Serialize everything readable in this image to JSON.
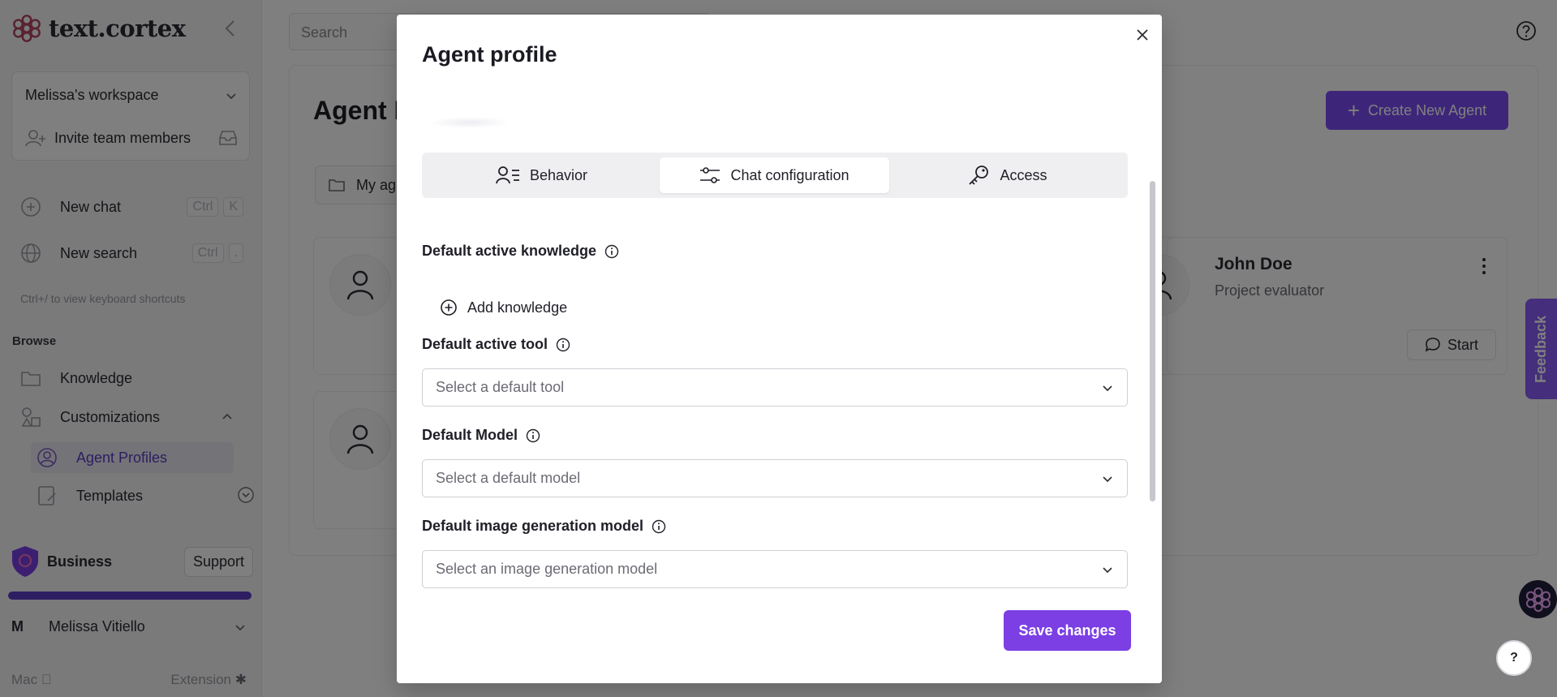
{
  "sidebar": {
    "brand": "text.cortex",
    "workspace": "Melissa's workspace",
    "invite": "Invite team members",
    "new_chat": {
      "label": "New chat",
      "keys": [
        "Ctrl",
        "K"
      ]
    },
    "new_search": {
      "label": "New search",
      "keys": [
        "Ctrl",
        "."
      ]
    },
    "shortcut_hint": "Ctrl+/ to view keyboard shortcuts",
    "browse_label": "Browse",
    "knowledge": "Knowledge",
    "customizations": "Customizations",
    "agent_profiles": "Agent Profiles",
    "templates": "Templates",
    "plan": "Business",
    "support": "Support",
    "plan_usage_fraction": 1.0,
    "user_initial": "M",
    "user_name": "Melissa Vitiello",
    "footer_left": "Mac",
    "footer_right": "Extension"
  },
  "main": {
    "search_placeholder": "Search",
    "page_title": "Agent P",
    "create_button": "Create New Agent",
    "folder_chip": "My ag",
    "agent_card": {
      "name": "John Doe",
      "role": "Project evaluator",
      "start": "Start"
    },
    "feedback": "Feedback",
    "help_fab": "?"
  },
  "modal": {
    "title": "Agent profile",
    "tabs": [
      {
        "label": "Behavior",
        "icon": "user-list-icon"
      },
      {
        "label": "Chat configuration",
        "icon": "sliders-icon"
      },
      {
        "label": "Access",
        "icon": "key-icon"
      }
    ],
    "active_tab": "Chat configuration",
    "knowledge_label": "Default active knowledge",
    "add_knowledge": "Add knowledge",
    "tool_label": "Default active tool",
    "tool_placeholder": "Select a default tool",
    "model_label": "Default Model",
    "model_placeholder": "Select a default model",
    "image_model_label": "Default image generation model",
    "image_model_placeholder": "Select an image generation model",
    "save_button": "Save changes"
  },
  "colors": {
    "accent": "#7b3fe4",
    "create_button": "#7b4df2",
    "feedback_tab": "#8b5cf6",
    "plan_progress": "#5b3cc4"
  }
}
